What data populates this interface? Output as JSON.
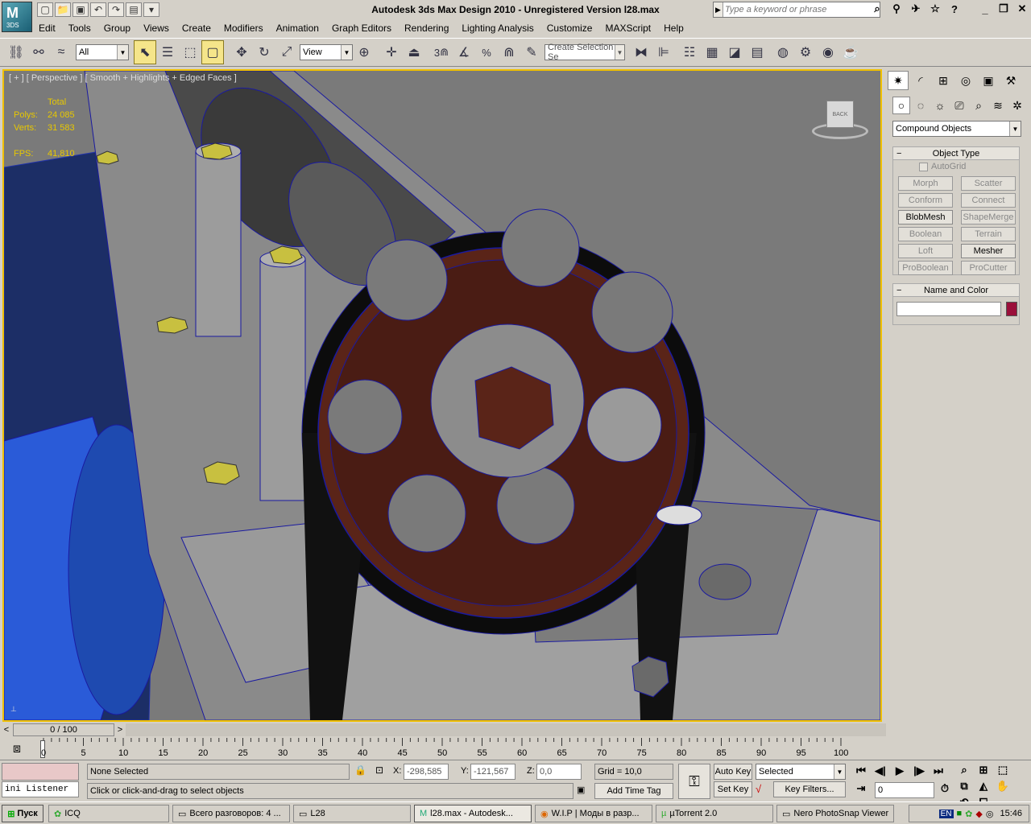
{
  "app": {
    "logo_text": "3DS",
    "title": "Autodesk 3ds Max Design 2010  - Unregistered Version     l28.max",
    "search_placeholder": "Type a keyword or phrase"
  },
  "menu": [
    "Edit",
    "Tools",
    "Group",
    "Views",
    "Create",
    "Modifiers",
    "Animation",
    "Graph Editors",
    "Rendering",
    "Lighting Analysis",
    "Customize",
    "MAXScript",
    "Help"
  ],
  "toolbar": {
    "selection_filter": "All",
    "reference_coord": "View",
    "snap_label": "3",
    "percent_label": "%",
    "named_selection_placeholder": "Create Selection Se"
  },
  "viewport": {
    "label": "[ + ] [ Perspective ] [ Smooth + Highlights + Edged Faces ]",
    "stats": {
      "total_label": "Total",
      "polys_label": "Polys:",
      "polys": "24 085",
      "verts_label": "Verts:",
      "verts": "31 583",
      "fps_label": "FPS:",
      "fps": "41,810"
    },
    "viewcube_label": "BACK"
  },
  "command_panel": {
    "category": "Compound Objects",
    "object_type_title": "Object Type",
    "autogrid": "AutoGrid",
    "buttons": [
      {
        "label": "Morph",
        "enabled": false
      },
      {
        "label": "Scatter",
        "enabled": false
      },
      {
        "label": "Conform",
        "enabled": false
      },
      {
        "label": "Connect",
        "enabled": false
      },
      {
        "label": "BlobMesh",
        "enabled": true
      },
      {
        "label": "ShapeMerge",
        "enabled": false
      },
      {
        "label": "Boolean",
        "enabled": false
      },
      {
        "label": "Terrain",
        "enabled": false
      },
      {
        "label": "Loft",
        "enabled": false
      },
      {
        "label": "Mesher",
        "enabled": true
      },
      {
        "label": "ProBoolean",
        "enabled": false
      },
      {
        "label": "ProCutter",
        "enabled": false
      }
    ],
    "name_color_title": "Name and Color",
    "object_name": "",
    "object_color": "#9a0f3a"
  },
  "timeline": {
    "slider": "0 / 100",
    "ticks": [
      "0",
      "5",
      "10",
      "15",
      "20",
      "25",
      "30",
      "35",
      "40",
      "45",
      "50",
      "55",
      "60",
      "65",
      "70",
      "75",
      "80",
      "85",
      "90",
      "95",
      "100"
    ]
  },
  "status": {
    "listener": "ini Listener",
    "selection": "None Selected",
    "prompt": "Click or click-and-drag to select objects",
    "x_label": "X:",
    "x": "-298,585",
    "y_label": "Y:",
    "y": "-121,567",
    "z_label": "Z:",
    "z": "0,0",
    "grid": "Grid = 10,0",
    "add_time_tag": "Add Time Tag",
    "auto_key": "Auto Key",
    "set_key": "Set Key",
    "key_mode": "Selected",
    "key_filters": "Key Filters...",
    "frame": "0"
  },
  "taskbar": {
    "start": "Пуск",
    "tasks": [
      "ICQ",
      "Всего разговоров: 4 ...",
      "L28",
      "l28.max - Autodesk...",
      "W.I.P | Моды в разр...",
      "µTorrent 2.0",
      "Nero PhotoSnap Viewer"
    ],
    "lang": "EN",
    "clock": "15:46"
  },
  "colors": {
    "viewport_bg": "#7a7a7a",
    "active_border": "#f0c000",
    "stats_color": "#e8c800",
    "wire": "#1a1aa0",
    "gear": "#5a2418"
  }
}
